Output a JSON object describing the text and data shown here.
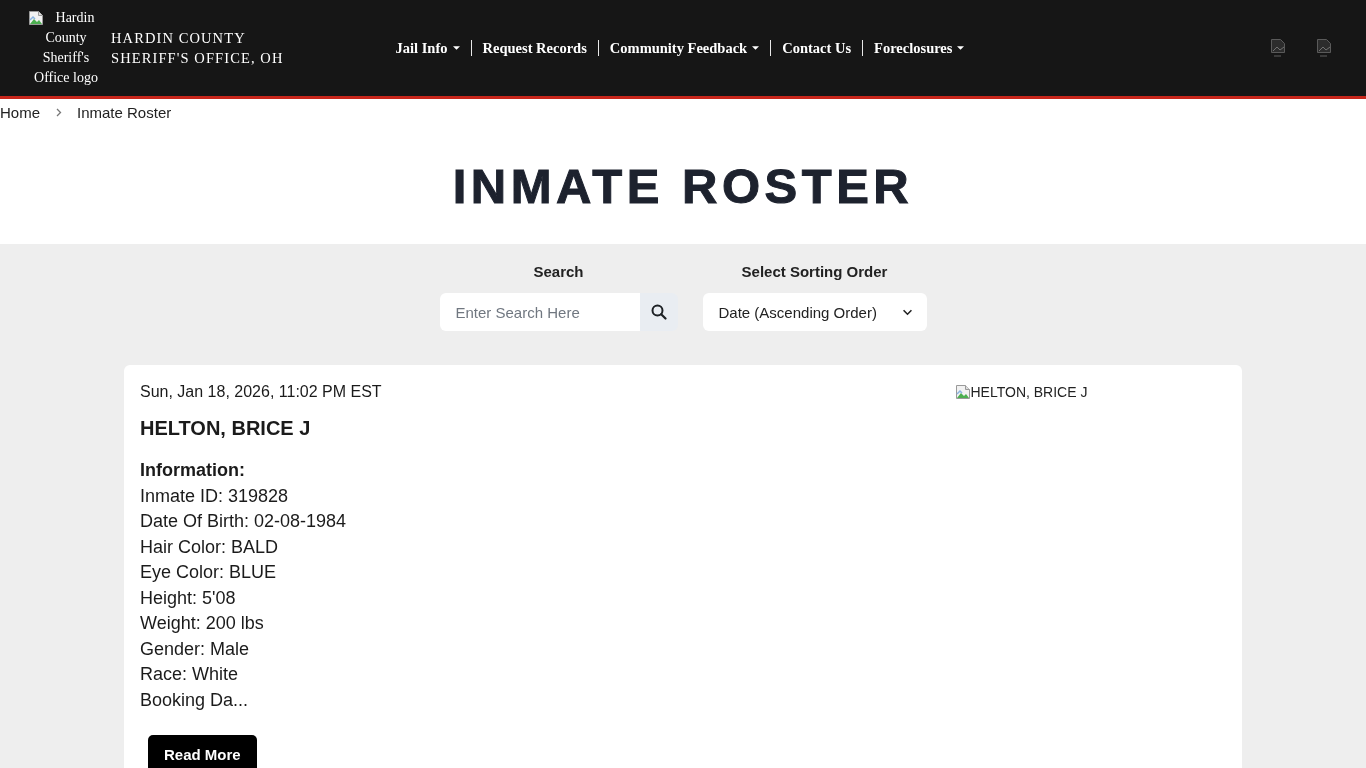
{
  "header": {
    "logo_alt": "Hardin County Sheriff's Office logo",
    "title_lines": [
      "HARDIN COUNTY",
      "SHERIFF'S OFFICE, OH"
    ],
    "nav": [
      {
        "label": "Jail Info",
        "has_dropdown": true
      },
      {
        "label": "Request Records",
        "has_dropdown": false
      },
      {
        "label": "Community Feedback",
        "has_dropdown": true
      },
      {
        "label": "Contact Us",
        "has_dropdown": false
      },
      {
        "label": "Foreclosures",
        "has_dropdown": true
      }
    ]
  },
  "breadcrumb": [
    "Home",
    "Inmate Roster"
  ],
  "page_title": "INMATE ROSTER",
  "search": {
    "label": "Search",
    "placeholder": "Enter Search Here"
  },
  "sort": {
    "label": "Select Sorting Order",
    "value": "Date (Ascending Order)"
  },
  "inmates": [
    {
      "date": "Sun, Jan 18, 2026, 11:02 PM EST",
      "name": "HELTON, BRICE J",
      "info_heading": "Information:",
      "details": [
        "Inmate ID: 319828",
        "Date Of Birth: 02-08-1984",
        "Hair Color: BALD",
        "Eye Color: BLUE",
        "Height: 5'08",
        "Weight: 200 lbs",
        "Gender: Male",
        "Race: White",
        "Booking Da..."
      ],
      "photo_alt": "HELTON, BRICE J",
      "button": "Read More"
    }
  ]
}
